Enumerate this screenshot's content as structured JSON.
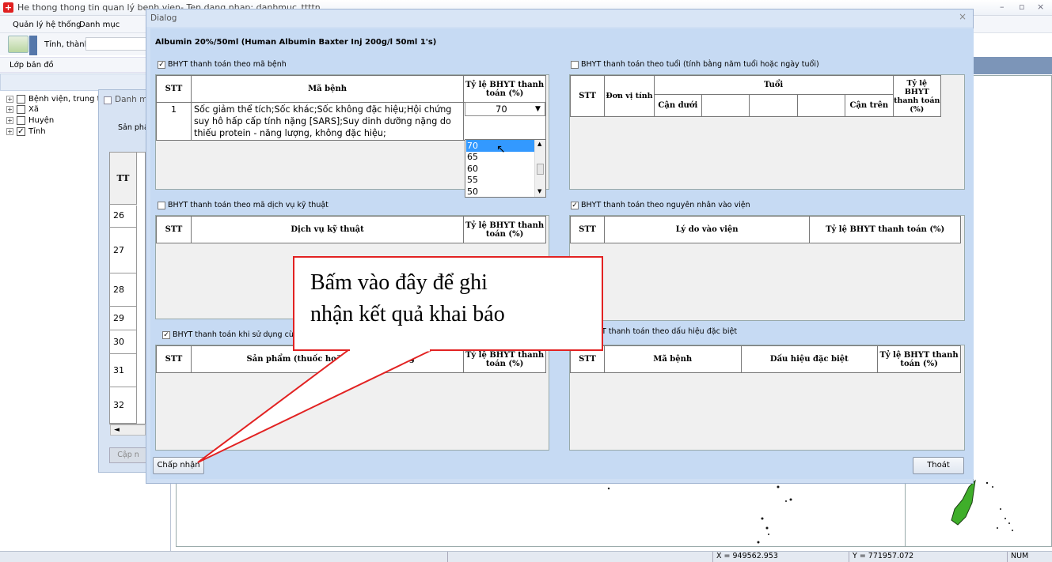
{
  "window": {
    "title": "He thong thong tin quan lý benh vien- Ten dang nhap: danhmuc_ttttn",
    "menus": [
      "Quản lý hệ thống",
      "Danh mục"
    ],
    "province_label": "Tỉnh, thành:",
    "layer_label": "Lớp bản đồ",
    "tree": [
      {
        "label": "Bệnh viện, trung tâm",
        "checked": false
      },
      {
        "label": "Xã",
        "checked": false
      },
      {
        "label": "Huyện",
        "checked": false
      },
      {
        "label": "Tỉnh",
        "checked": true
      }
    ],
    "status": {
      "x": "X = 949562.953",
      "y": "Y = 771957.072",
      "num": "NUM"
    }
  },
  "bg_dialog": {
    "title": "Danh m",
    "label": "Sản phẩm",
    "header": "TT",
    "rows": [
      "26",
      "27",
      "28",
      "29",
      "30",
      "31",
      "32"
    ],
    "update_button": "Cập n",
    "scroll_left": "◄"
  },
  "dialog": {
    "title": "Dialog",
    "close": "×",
    "product": "Albumin 20%/50ml (Human Albumin Baxter Inj 200g/l 50ml 1's)",
    "section_disease": {
      "label": "BHYT thanh toán theo mã bệnh",
      "checked": true,
      "headers": [
        "STT",
        "Mã bệnh",
        "Tỷ lệ BHYT thanh toán (%)"
      ],
      "rows": [
        {
          "stt": "1",
          "text": "Sốc giảm thể tích;Sốc khác;Sốc không đặc hiệu;Hội chứng suy hô hấp cấp tính nặng [SARS];Suy dinh dưỡng nặng do thiếu protein - năng lượng, không đặc hiệu;",
          "rate": "70"
        }
      ],
      "dropdown_options": [
        "70",
        "65",
        "60",
        "55",
        "50"
      ],
      "dropdown_selected": "70"
    },
    "section_age": {
      "label": "BHYT thanh toán theo tuổi (tính bằng năm tuổi hoặc ngày tuổi)",
      "checked": false,
      "headers": [
        "STT",
        "Đơn vị tính",
        "Tuổi",
        "Cận dưới",
        "Cận trên",
        "Tỷ lệ BHYT thanh toán (%)"
      ]
    },
    "section_service": {
      "label": "BHYT thanh toán theo mã dịch vụ kỹ thuật",
      "checked": false,
      "headers": [
        "STT",
        "Dịch vụ kỹ thuật",
        "Tỷ lệ BHYT thanh toán (%)"
      ]
    },
    "section_reason": {
      "label": "BHYT thanh toán theo nguyên nhân vào viện",
      "checked": true,
      "headers": [
        "STT",
        "Lý do vào viện",
        "Tỷ lệ BHYT thanh toán (%)"
      ]
    },
    "section_combo": {
      "label": "BHYT thanh toán khi sử dụng cùng sả",
      "checked": true,
      "headers": [
        "STT",
        "Sản phẩm (thuốc hoặc",
        "ng",
        "Tỷ lệ BHYT thanh toán (%)"
      ]
    },
    "section_sign": {
      "label": "T thanh toán theo dấu hiệu đặc biệt",
      "headers": [
        "STT",
        "Mã bệnh",
        "Dấu hiệu đặc biệt",
        "Tỷ lệ BHYT thanh toán (%)"
      ]
    },
    "accept_button": "Chấp nhận",
    "exit_button": "Thoát"
  },
  "callout": {
    "line1": "Bấm vào đây để ghi",
    "line2": "nhận kết quả khai báo"
  },
  "colors": {
    "dialog_bg": "#c6daf3",
    "callout_border": "#e22222",
    "selected_option": "#3399ff",
    "map_green": "#3fae2a"
  }
}
